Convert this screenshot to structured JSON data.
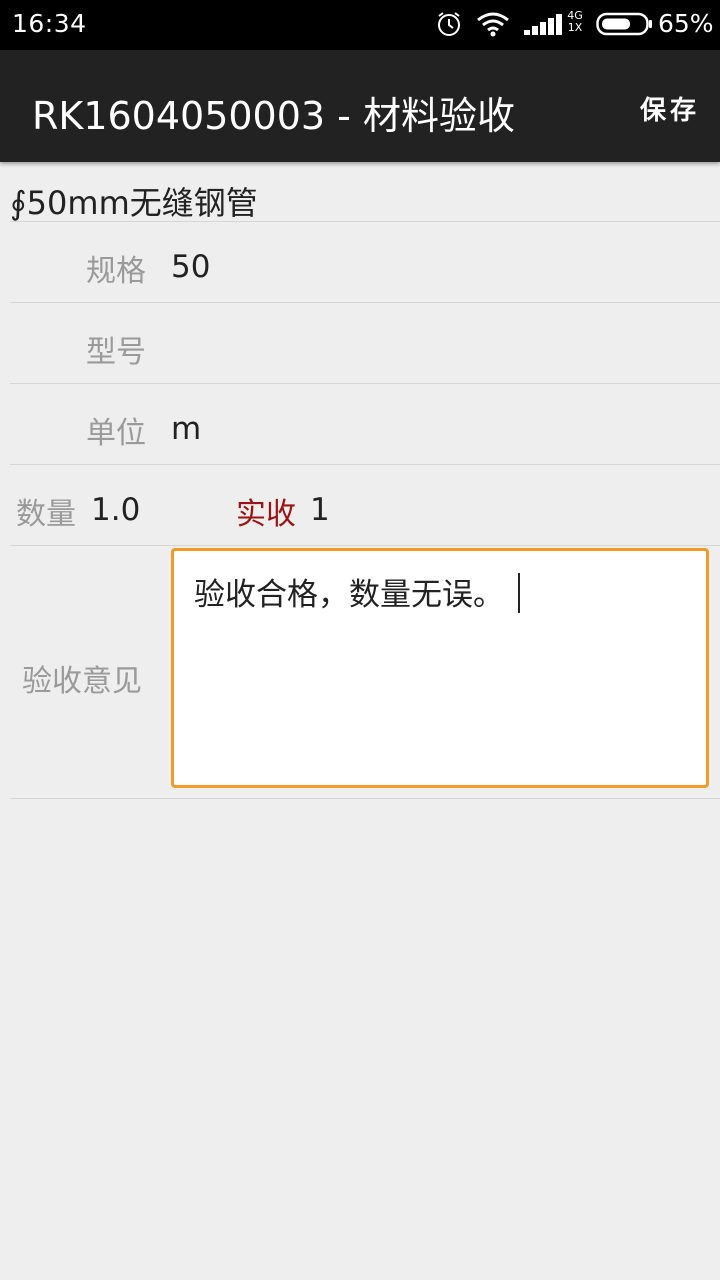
{
  "status_bar": {
    "time": "16:34",
    "network_top": "4G",
    "network_bottom": "1X",
    "battery_pct": "65%",
    "icons": [
      "alarm-icon",
      "wifi-icon",
      "signal-icon",
      "battery-icon"
    ]
  },
  "action_bar": {
    "title": "RK1604050003 - 材料验收",
    "save_label": "保存"
  },
  "material": {
    "name": "∮50mm无缝钢管"
  },
  "fields": {
    "spec_label": "规格",
    "spec_value": "50",
    "model_label": "型号",
    "model_value": "",
    "unit_label": "单位",
    "unit_value": "m",
    "quantity_label": "数量",
    "quantity_value": "1.0",
    "received_label": "实收",
    "received_value": "1",
    "opinion_label": "验收意见",
    "opinion_value": "验收合格，数量无误。"
  },
  "colors": {
    "action_bar": "#222222",
    "focus_border": "#f39a2a",
    "received_label": "#9b1414"
  }
}
